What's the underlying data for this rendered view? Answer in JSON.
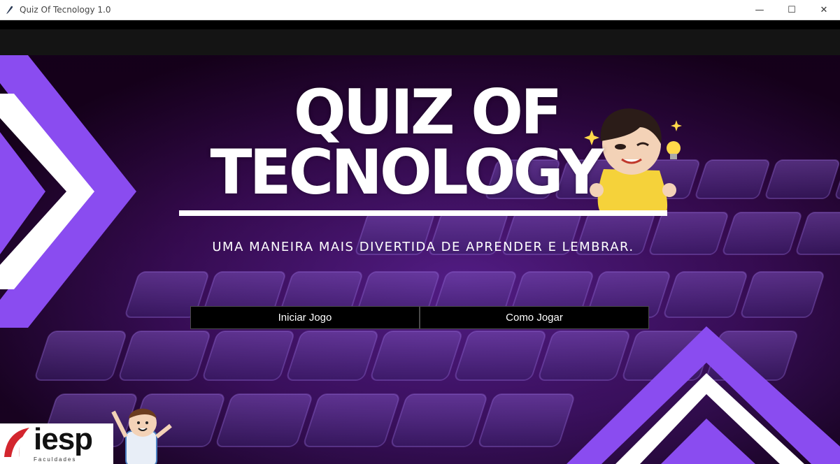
{
  "window": {
    "title": "Quiz Of Tecnology 1.0",
    "controls": {
      "minimize": "—",
      "maximize": "☐",
      "close": "✕"
    }
  },
  "hero": {
    "title_line1": "QUIZ OF",
    "title_line2": "TECNOLOGY",
    "subtitle": "UMA MANEIRA MAIS DIVERTIDA DE APRENDER E LEMBRAR."
  },
  "buttons": {
    "start_label": "Iniciar Jogo",
    "help_label": "Como Jogar"
  },
  "logo": {
    "text": "iesp",
    "subtext": "Faculdades"
  },
  "colors": {
    "accent_purple": "#8a4cf0",
    "button_bg": "#000000",
    "text": "#ffffff"
  },
  "icons": [
    "feather-icon",
    "minimize-icon",
    "maximize-icon",
    "close-icon"
  ]
}
